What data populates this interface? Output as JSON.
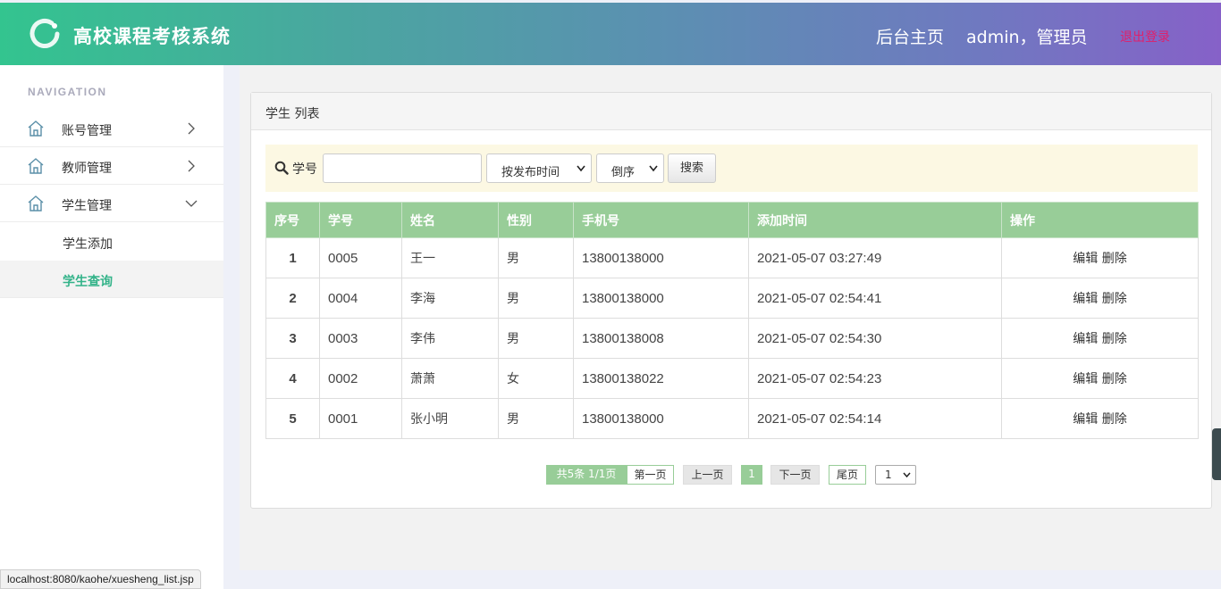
{
  "header": {
    "title": "高校课程考核系统",
    "home_label": "后台主页",
    "user_label": "admin，管理员",
    "logout_label": "退出登录"
  },
  "sidebar": {
    "nav_title": "NAVIGATION",
    "items": [
      {
        "label": "账号管理",
        "icon": "home-icon",
        "expanded": false
      },
      {
        "label": "教师管理",
        "icon": "home-icon",
        "expanded": false
      },
      {
        "label": "学生管理",
        "icon": "home-icon",
        "expanded": true
      }
    ],
    "sub_items": [
      {
        "label": "学生添加",
        "active": false
      },
      {
        "label": "学生查询",
        "active": true
      }
    ]
  },
  "panel": {
    "title": "学生 列表"
  },
  "search": {
    "label": "学号",
    "value": "",
    "sort_field": "按发布时间",
    "sort_order": "倒序",
    "button_label": "搜索"
  },
  "table": {
    "columns": [
      "序号",
      "学号",
      "姓名",
      "性别",
      "手机号",
      "添加时间",
      "操作"
    ],
    "rows": [
      {
        "idx": "1",
        "id": "0005",
        "name": "王一",
        "gender": "男",
        "phone": "13800138000",
        "time": "2021-05-07 03:27:49"
      },
      {
        "idx": "2",
        "id": "0004",
        "name": "李海",
        "gender": "男",
        "phone": "13800138000",
        "time": "2021-05-07 02:54:41"
      },
      {
        "idx": "3",
        "id": "0003",
        "name": "李伟",
        "gender": "男",
        "phone": "13800138008",
        "time": "2021-05-07 02:54:30"
      },
      {
        "idx": "4",
        "id": "0002",
        "name": "萧萧",
        "gender": "女",
        "phone": "13800138022",
        "time": "2021-05-07 02:54:23"
      },
      {
        "idx": "5",
        "id": "0001",
        "name": "张小明",
        "gender": "男",
        "phone": "13800138000",
        "time": "2021-05-07 02:54:14"
      }
    ],
    "edit_label": "编辑",
    "delete_label": "删除"
  },
  "pagination": {
    "info": "共5条  1/1页",
    "first": "第一页",
    "prev": "上一页",
    "current": "1",
    "next": "下一页",
    "last": "尾页",
    "page_select": "1"
  },
  "status_bar": {
    "url": "localhost:8080/kaohe/xuesheng_list.jsp"
  },
  "colors": {
    "accent_green": "#98cd98",
    "active_text": "#33b389",
    "logout": "#e0206a"
  }
}
